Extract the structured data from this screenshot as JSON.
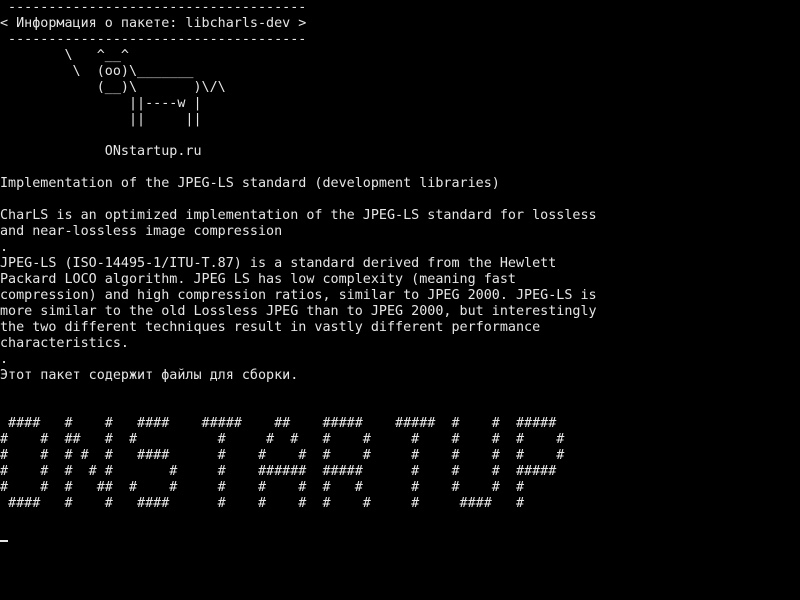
{
  "terminal": {
    "background_color": "#000000",
    "text_color": "#e6e6e6",
    "screen_text": " -------------------------------------\n< Информация о пакете: libcharls-dev >\n -------------------------------------\n        \\   ^__^\n         \\  (oo)\\_______\n            (__)\\       )\\/\\\n                ||----w |\n                ||     ||\n\n             ONstartup.ru\n\nImplementation of the JPEG-LS standard (development libraries)\n\nCharLS is an optimized implementation of the JPEG-LS standard for lossless\nand near-lossless image compression\n.\nJPEG-LS (ISO-14495-1/ITU-T.87) is a standard derived from the Hewlett\nPackard LOCO algorithm. JPEG LS has low complexity (meaning fast\ncompression) and high compression ratios, similar to JPEG 2000. JPEG-LS is\nmore similar to the old Lossless JPEG than to JPEG 2000, but interestingly\nthe two different techniques result in vastly different performance\ncharacteristics.\n.\nЭтот пакет содержит файлы для сборки.\n\n\n ####   #    #   ####    #####    ##    #####    #####  #    #  #####\n#    #  ##   #  #          #     #  #   #    #     #    #    #  #    #\n#    #  # #  #   ####      #    #    #  #    #     #    #    #  #    #\n#    #  #  # #       #     #    ######  #####      #    #    #  #####\n#    #  #   ##  #    #     #    #    #  #   #      #    #    #  #\n ####   #    #   ####      #    #    #  #    #     #     ####   #"
  }
}
